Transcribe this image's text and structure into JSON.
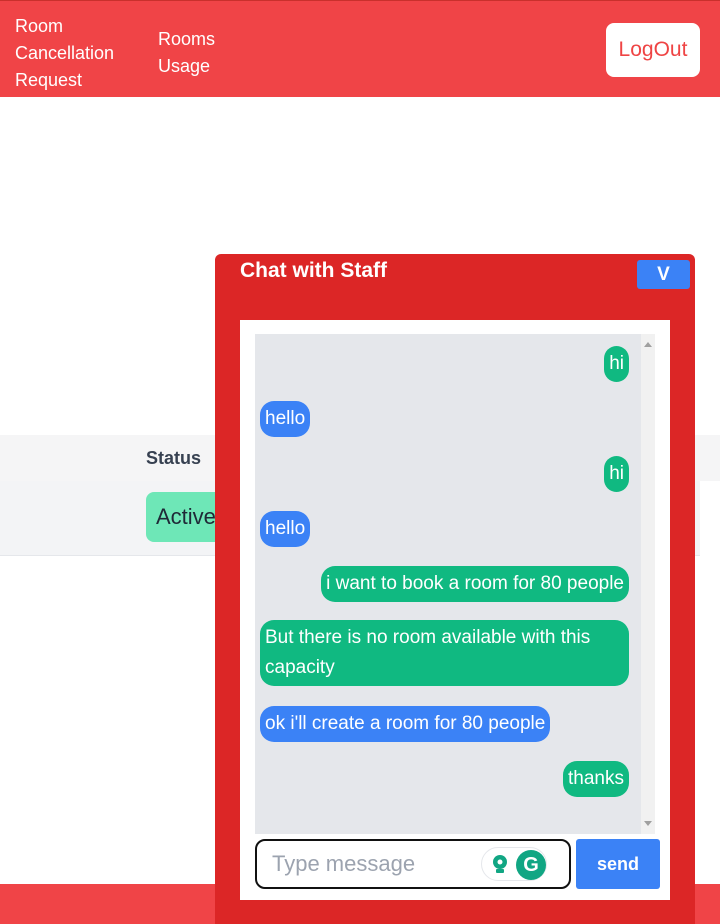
{
  "nav": {
    "links": [
      "Room Cancellation Request",
      "Rooms Usage"
    ],
    "logout_label": "LogOut"
  },
  "table": {
    "status_header": "Status",
    "status_value": "Active"
  },
  "chat": {
    "title": "Chat with Staff",
    "collapse_label": "V",
    "messages": [
      {
        "text": "hi",
        "sender": "me"
      },
      {
        "text": "hello",
        "sender": "staff"
      },
      {
        "text": "hi",
        "sender": "me"
      },
      {
        "text": "hello",
        "sender": "staff"
      },
      {
        "text": "i want to book a room for 80 people",
        "sender": "me"
      },
      {
        "text": "But there is no room available with this capacity",
        "sender": "me"
      },
      {
        "text": "ok i'll create a room for 80 people",
        "sender": "staff"
      },
      {
        "text": "thanks",
        "sender": "me"
      }
    ],
    "input_placeholder": "Type message",
    "send_label": "send"
  },
  "colors": {
    "navbar": "#f04447",
    "chat_panel": "#dc2626",
    "my_bubble": "#10b981",
    "staff_bubble": "#3b82f6",
    "status_active": "#6ee7b7"
  }
}
